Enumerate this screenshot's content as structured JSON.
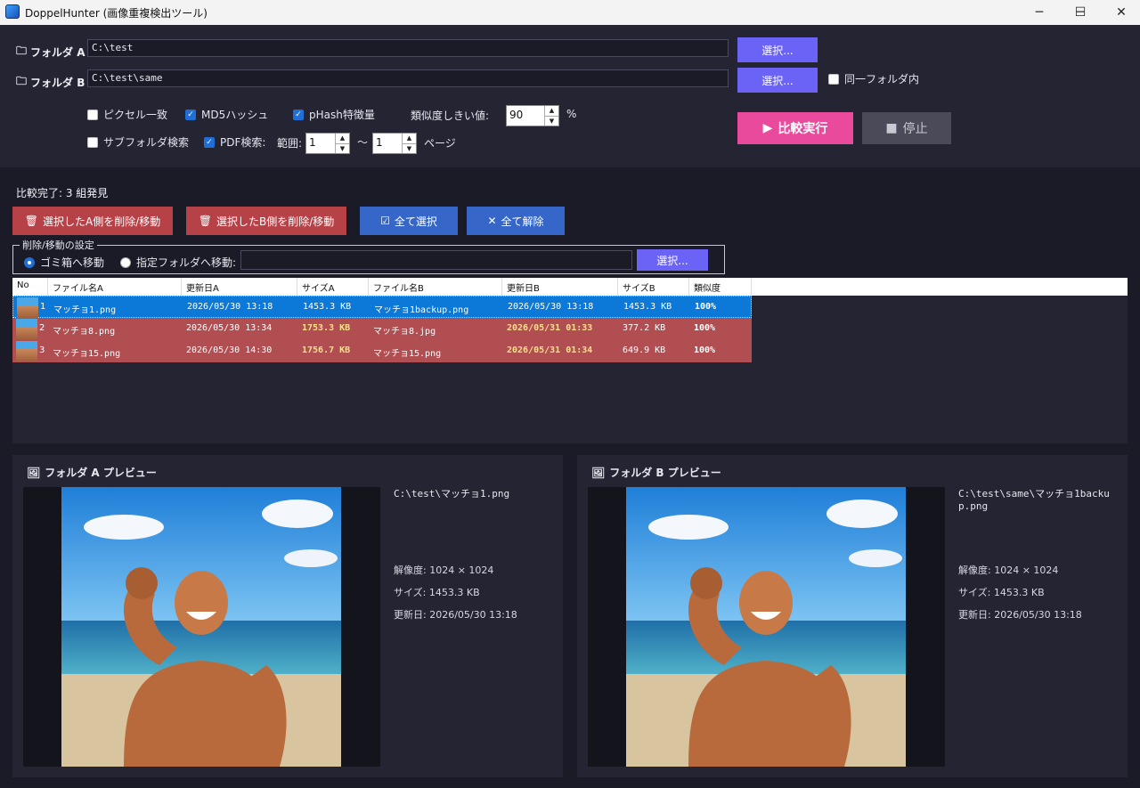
{
  "window": {
    "title": "DoppelHunter (画像重複検出ツール)",
    "controls": [
      "─",
      "☐",
      "✕"
    ]
  },
  "settings": {
    "folder_a_label": "フォルダ A",
    "folder_a_path": "C:\\test",
    "folder_b_label": "フォルダ B",
    "folder_b_path": "C:\\test\\same",
    "select_label": "選択...",
    "same_folder_label": "同一フォルダ内",
    "same_folder_checked": false,
    "pixel_match": {
      "label": "ピクセル一致",
      "checked": false
    },
    "md5": {
      "label": "MD5ハッシュ",
      "checked": true
    },
    "phash": {
      "label": "pHash特徴量",
      "checked": true
    },
    "threshold_label": "類似度しきい値:",
    "threshold_value": "90",
    "threshold_unit": "%",
    "subfolder": {
      "label": "サブフォルダ検索",
      "checked": false
    },
    "pdf": {
      "label": "PDF検索:",
      "checked": true
    },
    "range_label": "範囲:",
    "range_from": "1",
    "range_sep": "〜",
    "range_to": "1",
    "range_unit": "ページ",
    "run_label": "比較実行",
    "stop_label": "停止"
  },
  "results": {
    "status": "比較完了: 3 組発見",
    "delete_a_label": "選択したA側を削除/移動",
    "delete_b_label": "選択したB側を削除/移動",
    "select_all_label": "全て選択",
    "deselect_all_label": "全て解除",
    "move_settings_legend": "削除/移動の設定",
    "trash_label": "ゴミ箱へ移動",
    "folder_move_label": "指定フォルダへ移動:",
    "move_target": "",
    "move_select_label": "選択..."
  },
  "table": {
    "headers": [
      "No",
      "ファイル名A",
      "更新日A",
      "サイズA",
      "ファイル名B",
      "更新日B",
      "サイズB",
      "類似度"
    ],
    "rows": [
      {
        "no": "1",
        "name_a": "マッチョ1.png",
        "date_a": "2026/05/30 13:18",
        "size_a": "1453.3 KB",
        "name_b": "マッチョ1backup.png",
        "date_b": "2026/05/30 13:18",
        "size_b": "1453.3 KB",
        "similarity": "100%",
        "state": "selected"
      },
      {
        "no": "2",
        "name_a": "マッチョ8.png",
        "date_a": "2026/05/30 13:34",
        "size_a": "1753.3 KB",
        "name_b": "マッチョ8.jpg",
        "date_b": "2026/05/31 01:33",
        "size_b": "377.2 KB",
        "similarity": "100%",
        "state": "diff"
      },
      {
        "no": "3",
        "name_a": "マッチョ15.png",
        "date_a": "2026/05/30 14:30",
        "size_a": "1756.7 KB",
        "name_b": "マッチョ15.png",
        "date_b": "2026/05/31 01:34",
        "size_b": "649.9 KB",
        "similarity": "100%",
        "state": "diff"
      }
    ]
  },
  "preview_a": {
    "title": "フォルダ A プレビュー",
    "path": "C:\\test\\マッチョ1.png",
    "resolution": "解像度: 1024 × 1024",
    "size": "サイズ: 1453.3 KB",
    "modified": "更新日: 2026/05/30 13:18"
  },
  "preview_b": {
    "title": "フォルダ B プレビュー",
    "path": "C:\\test\\same\\マッチョ1backup.png",
    "resolution": "解像度: 1024 × 1024",
    "size": "サイズ: 1453.3 KB",
    "modified": "更新日: 2026/05/30 13:18"
  },
  "colors": {
    "background": "#1b1b27",
    "panel": "#242433",
    "accent_purple": "#6b63f5",
    "run_pink": "#ea4a9c",
    "delete_red": "#b64147",
    "select_blue": "#3566c8",
    "row_selected": "#0c79d8",
    "row_diff": "#b04e52"
  }
}
